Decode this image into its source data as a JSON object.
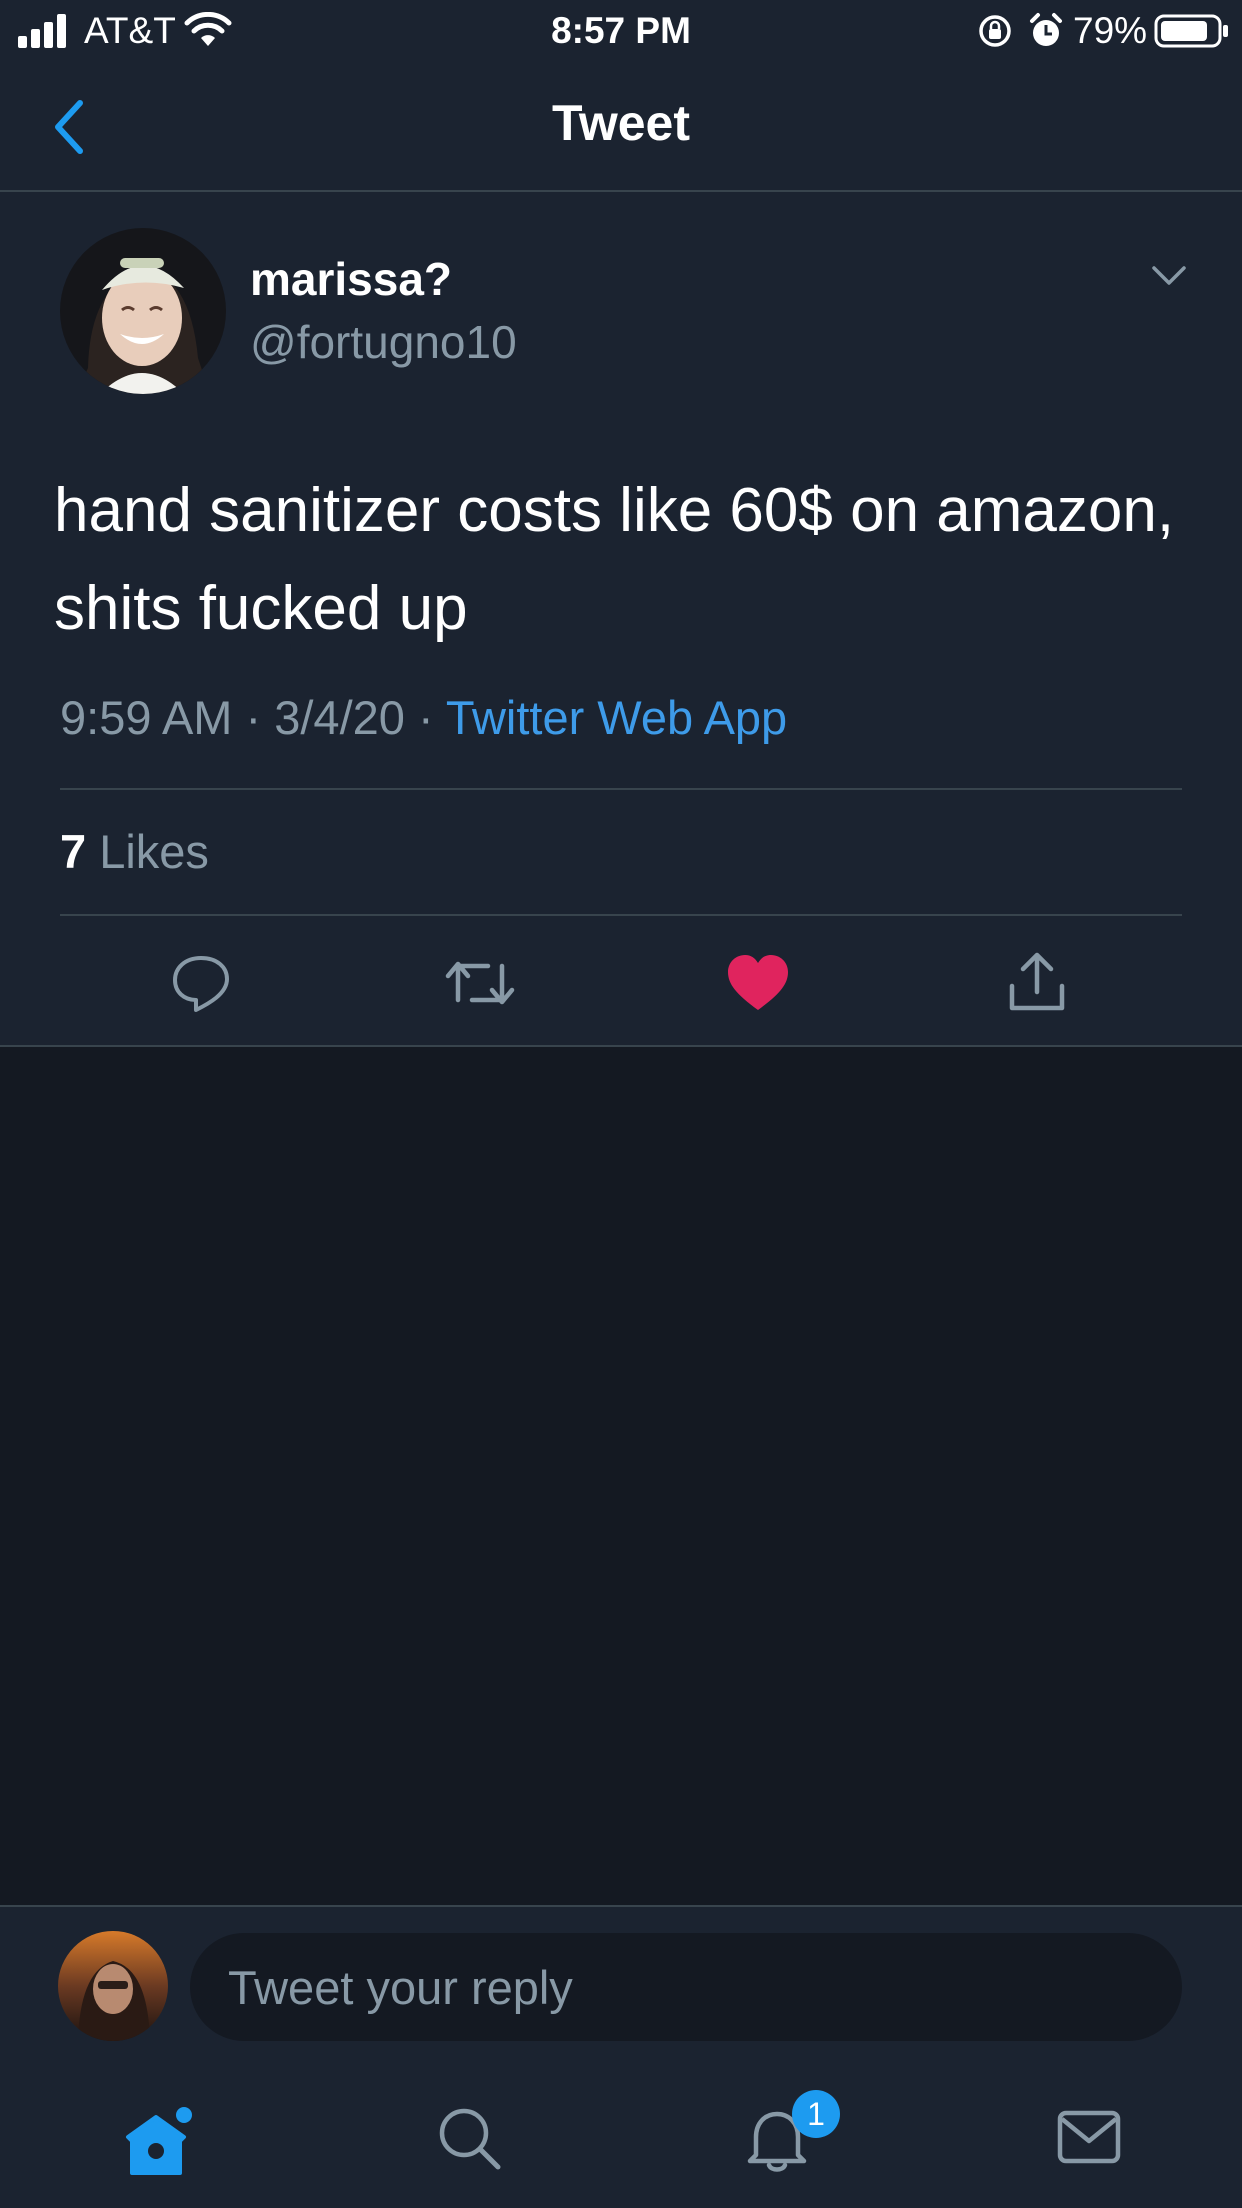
{
  "status_bar": {
    "carrier": "AT&T",
    "time": "8:57 PM",
    "battery": "79%"
  },
  "nav": {
    "title": "Tweet"
  },
  "tweet": {
    "author_name": "marissa?",
    "author_handle": "@fortugno10",
    "text": "hand sanitizer costs like 60$ on amazon, shits fucked up",
    "time": "9:59 AM",
    "date": "3/4/20",
    "source": "Twitter Web App",
    "likes_count": "7",
    "likes_label": "Likes",
    "liked": true
  },
  "reply": {
    "placeholder": "Tweet your reply"
  },
  "tabs": {
    "notifications_badge": "1"
  },
  "colors": {
    "accent": "#1d9bf0",
    "like": "#e0245e",
    "background": "#141922",
    "panel": "#1b2330",
    "secondary_text": "#8899a6"
  },
  "icons": [
    "signal-icon",
    "wifi-icon",
    "rotation-lock-icon",
    "alarm-icon",
    "battery-icon",
    "back-chevron-icon",
    "more-chevron-icon",
    "reply-icon",
    "retweet-icon",
    "heart-icon",
    "share-icon",
    "home-icon",
    "search-icon",
    "bell-icon",
    "mail-icon"
  ]
}
